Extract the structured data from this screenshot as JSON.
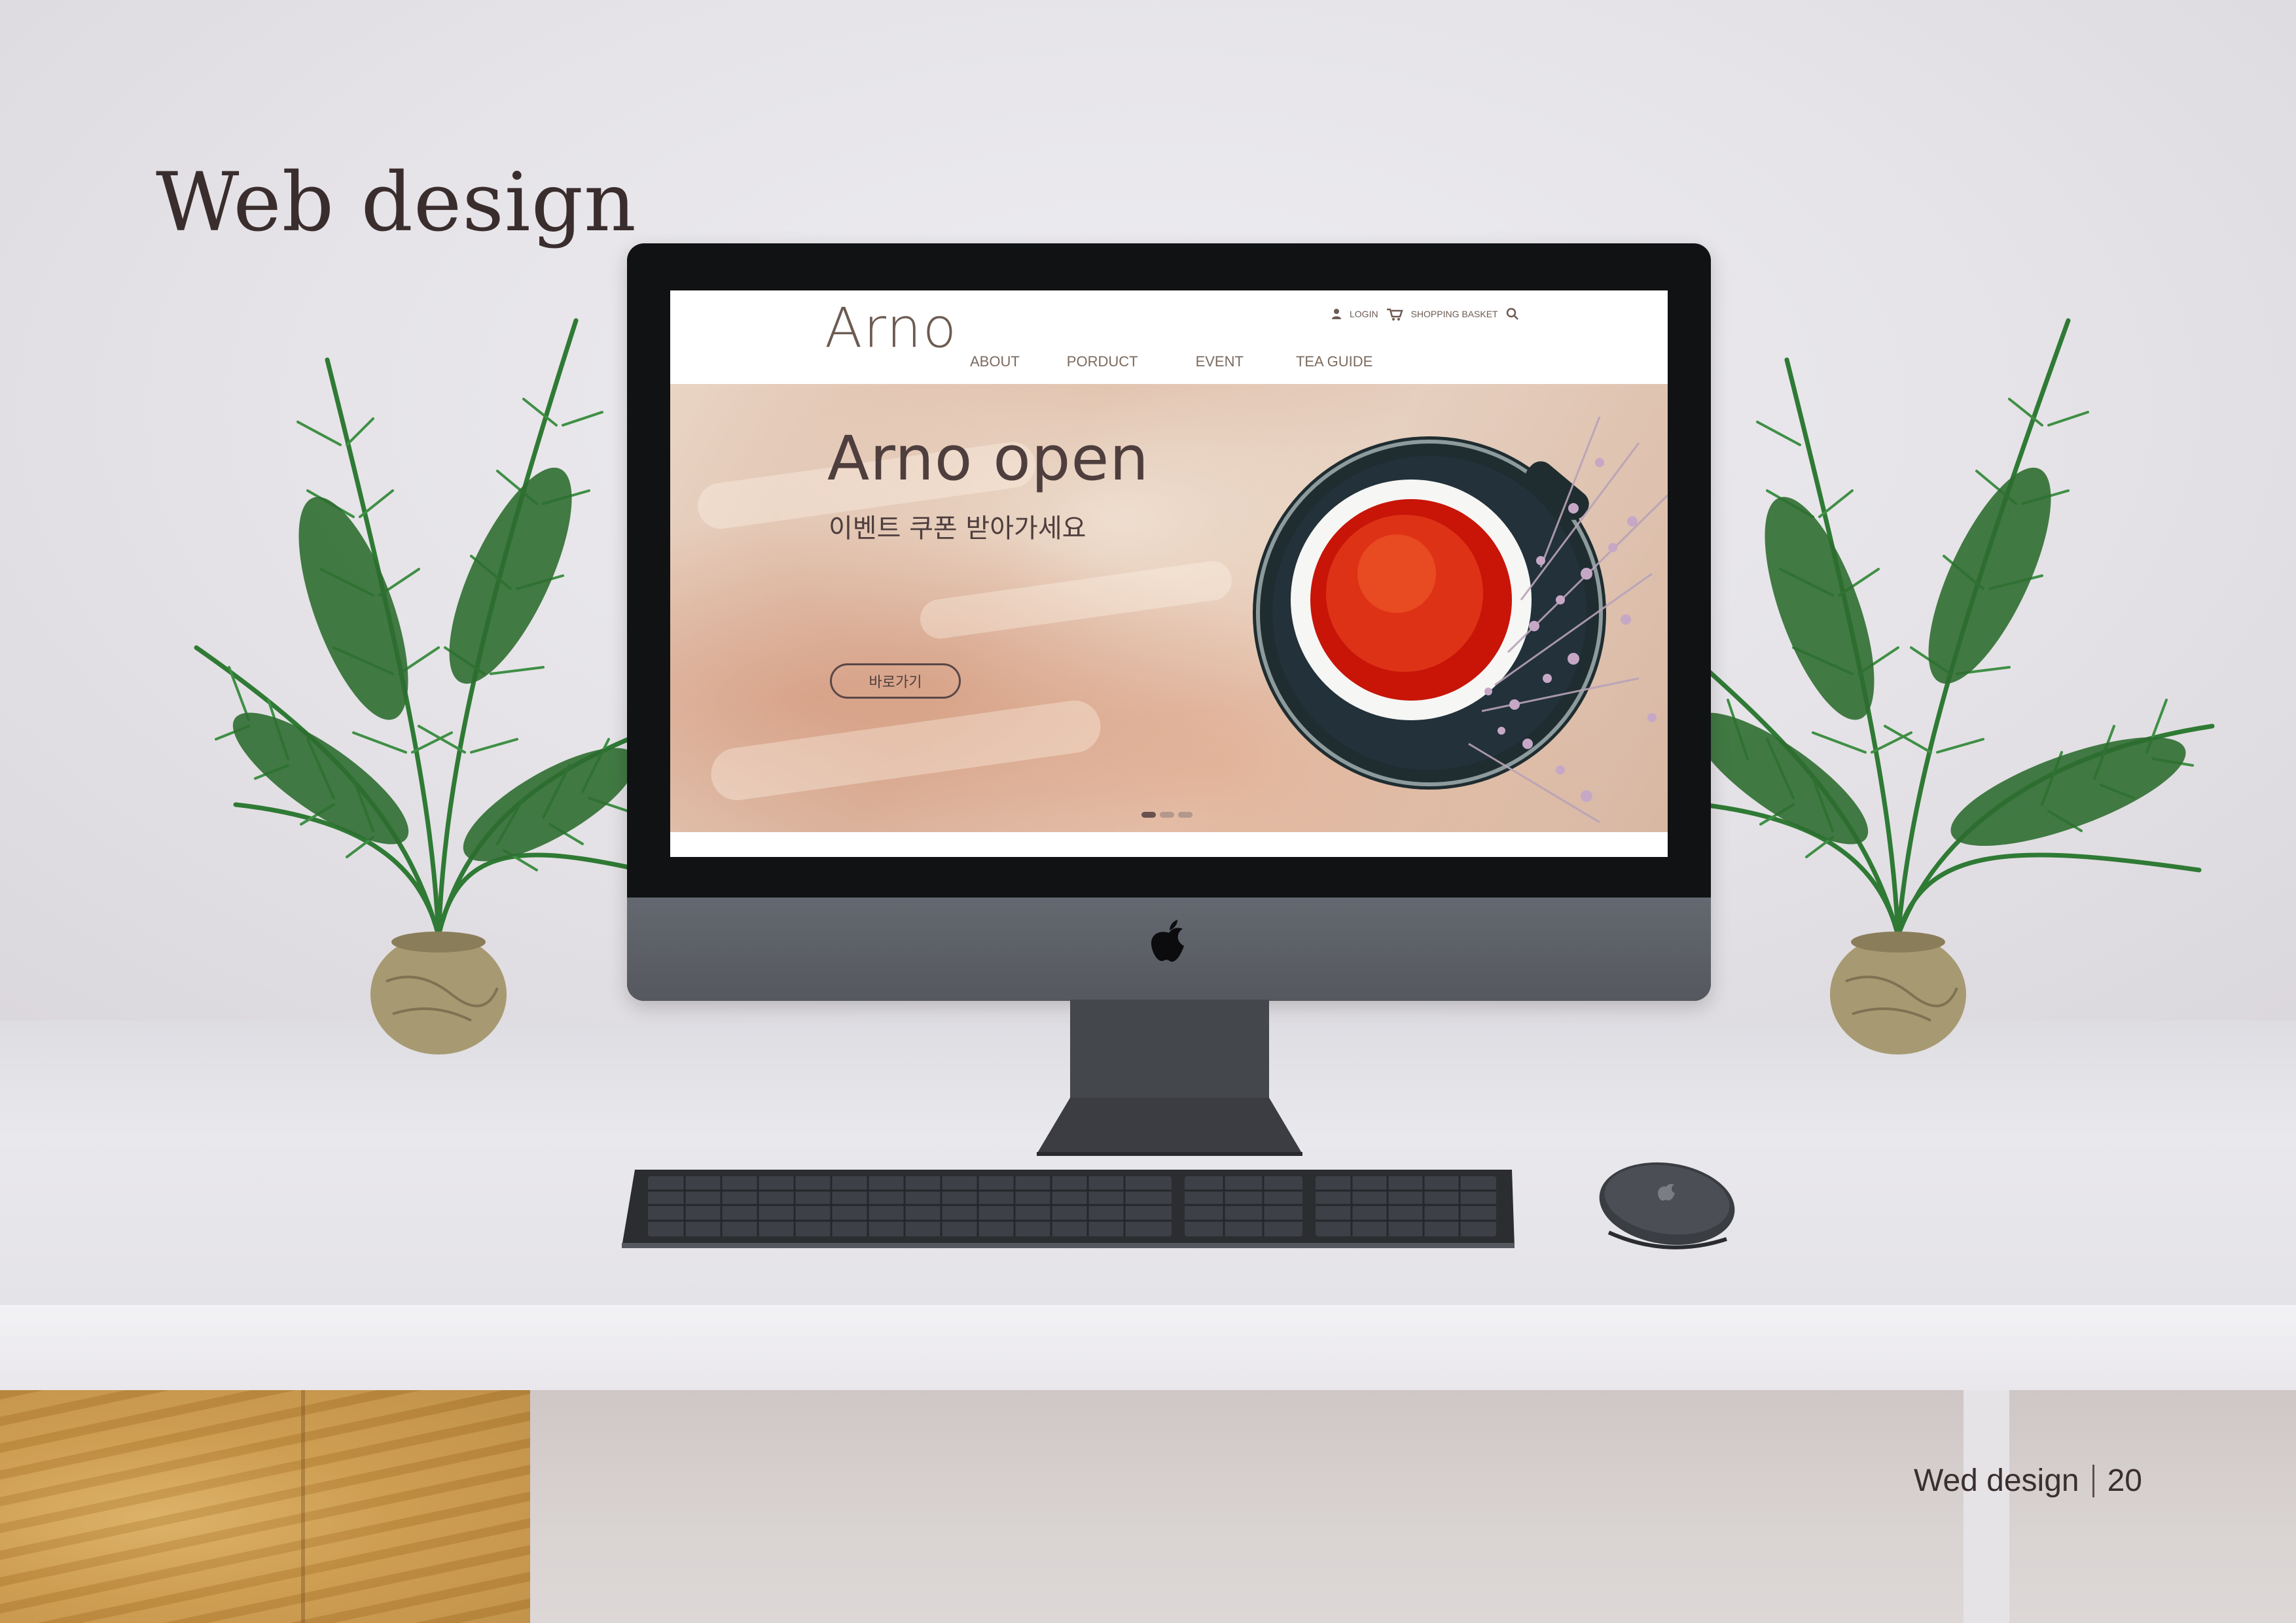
{
  "slide": {
    "heading": "Web design",
    "footer_label": "Wed design",
    "page_number": "20"
  },
  "site": {
    "logo": "Arno",
    "utility": {
      "login": "LOGIN",
      "basket": "SHOPPING BASKET"
    },
    "nav": [
      "ABOUT",
      "PORDUCT",
      "EVENT",
      "TEA GUIDE"
    ],
    "hero": {
      "title": "Arno open",
      "subtitle": "이벤트 쿠폰 받아가세요",
      "button": "바로가기"
    },
    "slider": {
      "count": 3,
      "active": 1
    }
  },
  "colors": {
    "text_dark": "#3a2d2d",
    "brand_brown": "#6d5b52",
    "tea_red": "#d4190a"
  },
  "icons": [
    "user-icon",
    "cart-icon",
    "search-icon",
    "apple-icon"
  ]
}
